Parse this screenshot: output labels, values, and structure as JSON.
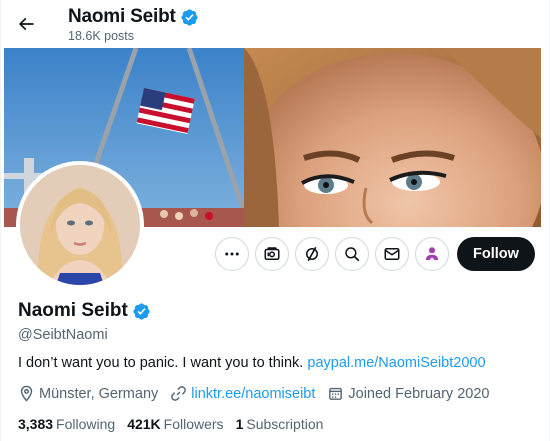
{
  "header": {
    "name": "Naomi Seibt",
    "posts": "18.6K posts"
  },
  "profile": {
    "name": "Naomi Seibt",
    "handle": "@SeibtNaomi",
    "bio_text": "I don’t want you to panic. I want you to think.",
    "bio_link": "paypal.me/NaomiSeibt2000",
    "location": "Münster, Germany",
    "website": "linktr.ee/naomiseibt",
    "joined": "Joined February 2020"
  },
  "stats": {
    "following_count": "3,383",
    "following_label": "Following",
    "followers_count": "421K",
    "followers_label": "Followers",
    "subscriptions_count": "1",
    "subscriptions_label": "Subscription"
  },
  "actions": {
    "follow_label": "Follow",
    "icons": [
      "more-icon",
      "grok-icon",
      "repost-icon",
      "search-icon",
      "message-icon",
      "subscribe-icon"
    ]
  },
  "colors": {
    "accent": "#1d9bf0",
    "text_primary": "#0f1419",
    "text_secondary": "#536471",
    "follow_bg": "#0f1419",
    "subscribe_icon": "#a13eb0"
  }
}
